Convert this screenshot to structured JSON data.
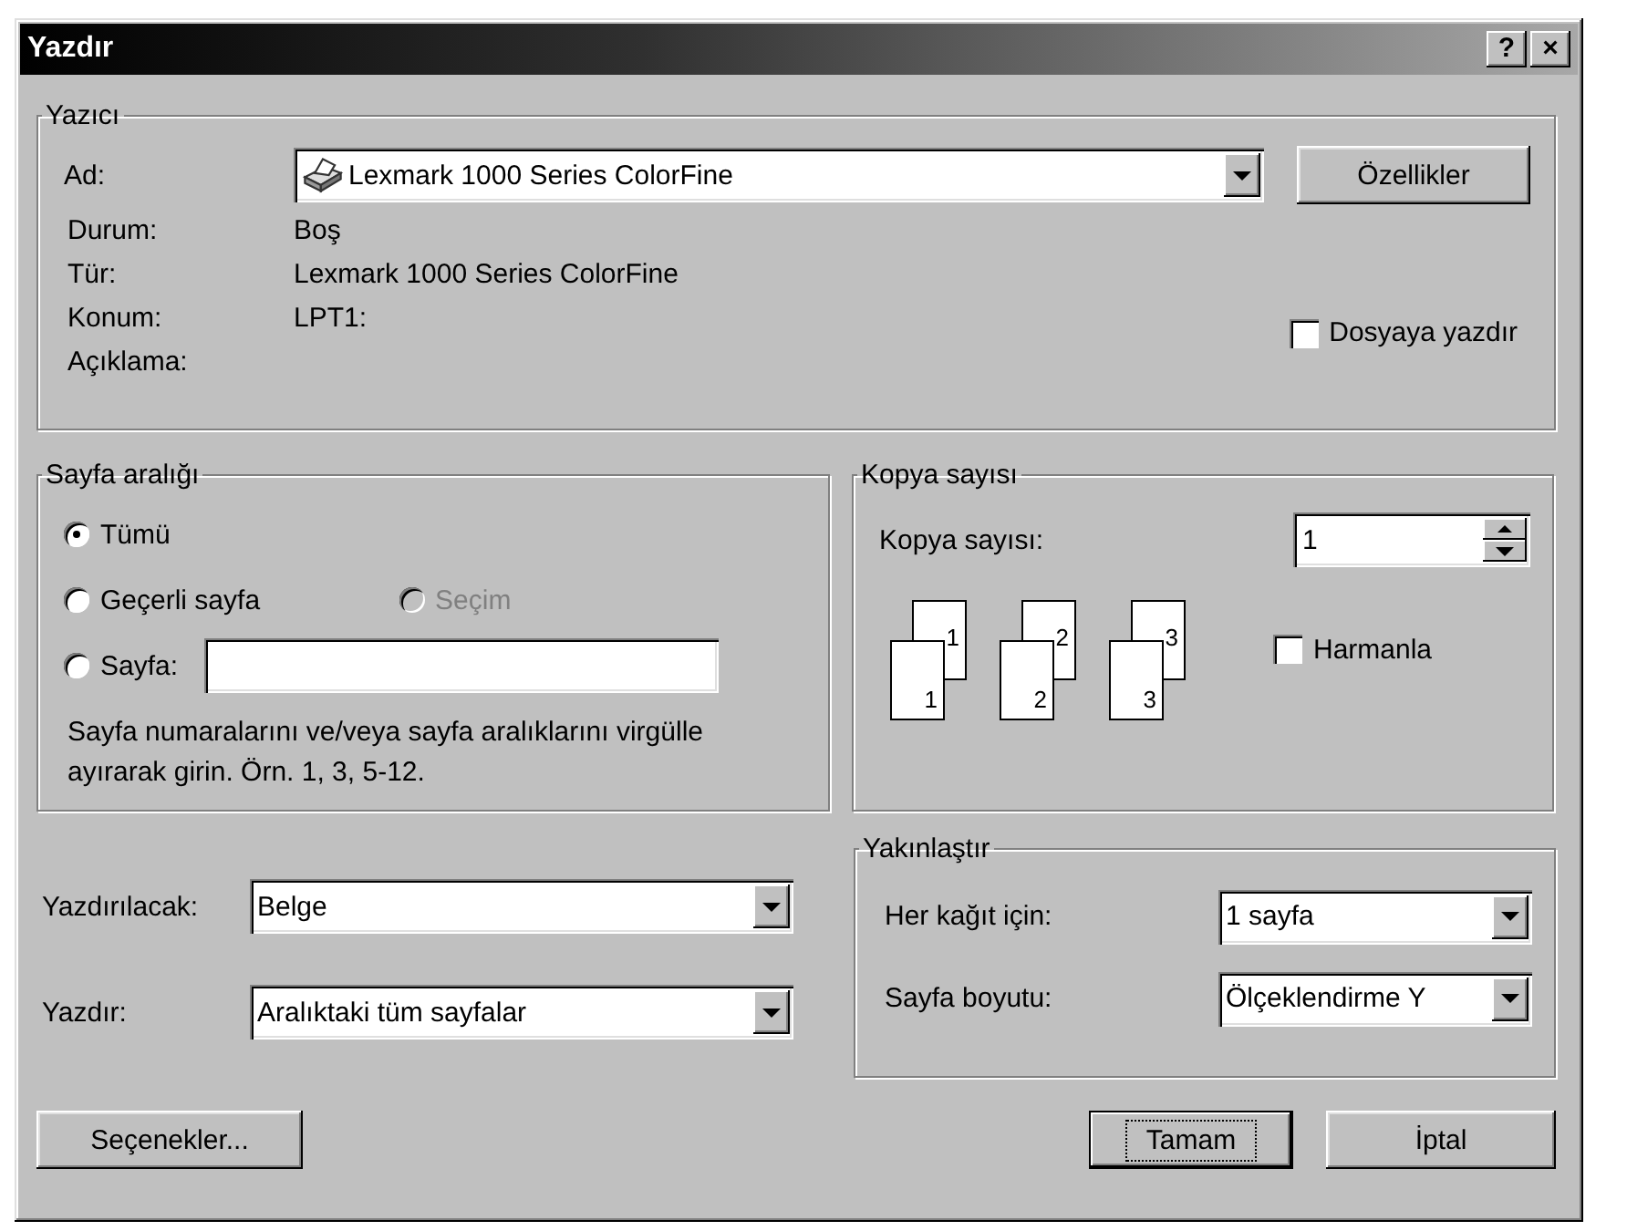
{
  "window": {
    "title": "Yazdır",
    "help_button": "?",
    "close_button": "×"
  },
  "printer": {
    "group_label": "Yazıcı",
    "name_label": "Ad:",
    "name_value": "Lexmark 1000 Series ColorFine",
    "properties_button": "Özellikler",
    "info": [
      {
        "label": "Durum:",
        "value": "Boş"
      },
      {
        "label": "Tür:",
        "value": "Lexmark 1000 Series ColorFine"
      },
      {
        "label": "Konum:",
        "value": "LPT1:"
      },
      {
        "label": "Açıklama:"
      }
    ],
    "print_to_file": {
      "label": "Dosyaya yazdır",
      "checked": false
    }
  },
  "page_range": {
    "group_label": "Sayfa aralığı",
    "options": [
      {
        "label": "Tümü",
        "selected": true,
        "disabled": false
      },
      {
        "label": "Geçerli sayfa",
        "selected": false,
        "disabled": false
      },
      {
        "label": "Seçim",
        "selected": false,
        "disabled": true
      },
      {
        "label": "Sayfa:",
        "selected": false,
        "disabled": false
      }
    ],
    "hint": "Sayfa numaralarını ve/veya sayfa aralıklarını virgülle ayırarak girin. Örn. 1, 3, 5-12."
  },
  "copies": {
    "group_label": "Kopya sayısı",
    "count_label": "Kopya sayısı:",
    "count_value": "1",
    "stacks": [
      {
        "back": "1",
        "front": "1"
      },
      {
        "back": "2",
        "front": "2"
      },
      {
        "back": "3",
        "front": "3"
      }
    ],
    "collate": {
      "label": "Harmanla",
      "checked": false
    }
  },
  "print_fields": [
    {
      "label": "Yazdırılacak:",
      "value": "Belge"
    },
    {
      "label": "Yazdır:",
      "value": "Aralıktaki tüm sayfalar"
    }
  ],
  "zoom": {
    "group_label": "Yakınlaştır",
    "fields": [
      {
        "label": "Her kağıt için:",
        "value": "1 sayfa"
      },
      {
        "label": "Sayfa boyutu:",
        "value": "Ölçeklendirme Y"
      }
    ]
  },
  "buttons": [
    {
      "label": "Seçenekler...",
      "default": false
    },
    {
      "label": "Tamam",
      "default": true
    },
    {
      "label": "İptal",
      "default": false
    }
  ]
}
